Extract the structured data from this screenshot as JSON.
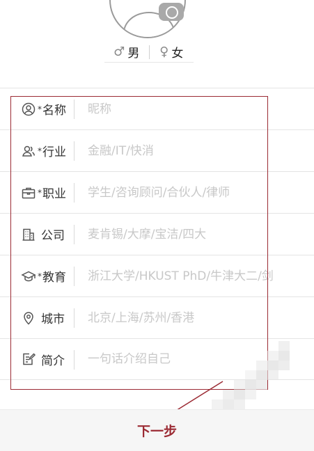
{
  "gender": {
    "male": {
      "symbol": "♂",
      "label": "男"
    },
    "female": {
      "symbol": "♀",
      "label": "女"
    }
  },
  "fields": [
    {
      "id": "name",
      "icon": "user-circle-icon",
      "required": true,
      "label": "名称",
      "placeholder": "昵称"
    },
    {
      "id": "industry",
      "icon": "users-icon",
      "required": true,
      "label": "行业",
      "placeholder": "金融/IT/快消"
    },
    {
      "id": "occupation",
      "icon": "briefcase-icon",
      "required": true,
      "label": "职业",
      "placeholder": "学生/咨询顾问/合伙人/律师"
    },
    {
      "id": "company",
      "icon": "building-icon",
      "required": false,
      "label": "公司",
      "placeholder": "麦肯锡/大摩/宝洁/四大"
    },
    {
      "id": "education",
      "icon": "graduation-cap-icon",
      "required": true,
      "label": "教育",
      "placeholder": "浙江大学/HKUST PhD/牛津大二/剑"
    },
    {
      "id": "city",
      "icon": "location-pin-icon",
      "required": false,
      "label": "城市",
      "placeholder": "北京/上海/苏州/香港"
    },
    {
      "id": "intro",
      "icon": "edit-note-icon",
      "required": false,
      "label": "简介",
      "placeholder": "一句话介绍自己"
    }
  ],
  "required_mark": "*",
  "next_button": {
    "label": "下一步"
  },
  "colors": {
    "accent": "#9b2a33",
    "placeholder": "#c8c8c8",
    "divider": "#e4e4e4"
  }
}
